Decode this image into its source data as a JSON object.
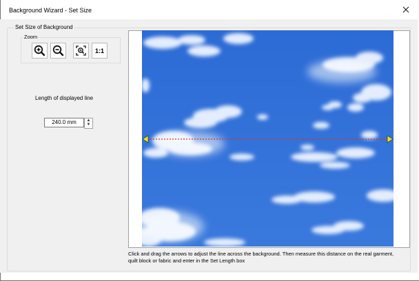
{
  "window": {
    "title": "Background Wizard - Set Size"
  },
  "group": {
    "label": "Set Size of Background"
  },
  "zoom": {
    "label": "Zoom",
    "buttons": [
      {
        "name": "zoom-in",
        "icon": "zoom-in-icon"
      },
      {
        "name": "zoom-out",
        "icon": "zoom-out-icon"
      },
      {
        "name": "zoom-fit",
        "icon": "zoom-fit-icon"
      },
      {
        "name": "zoom-actual",
        "icon": "zoom-actual-icon",
        "label": "1:1"
      }
    ]
  },
  "length": {
    "label": "Length of displayed line",
    "value": "240.0 mm"
  },
  "instructions": "Click and drag the arrows to adjust the line across the background. Then measure this distance on the real garment, quilt block or fabric and enter in the Set Length box",
  "colors": {
    "sky": "#2f6fd6",
    "line": "#d23b1f",
    "arrow": "#f2e200",
    "dialog_bg": "#f0f0f0"
  }
}
